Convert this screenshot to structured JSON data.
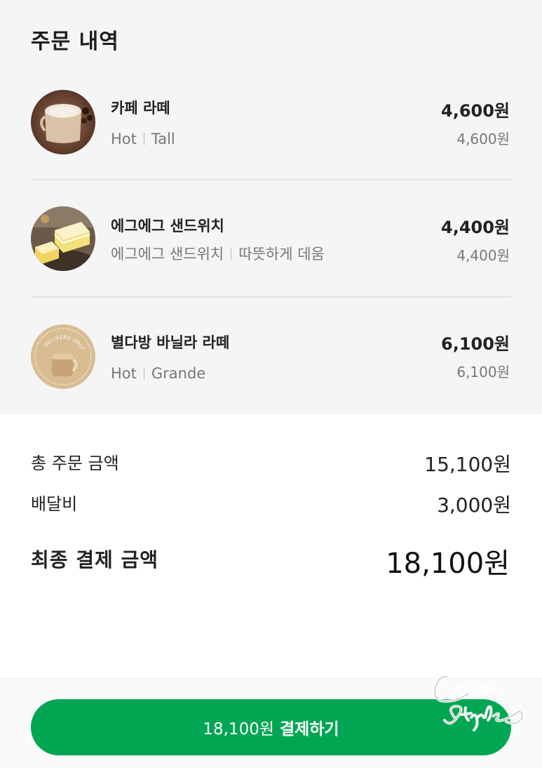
{
  "order": {
    "title": "주문 내역",
    "items": [
      {
        "name": "카페 라떼",
        "options": [
          "Hot",
          "Tall"
        ],
        "price": "4,600원",
        "subprice": "4,600원",
        "thumb_icon": "cafe-latte-image"
      },
      {
        "name": "에그에그 샌드위치",
        "options": [
          "에그에그 샌드위치",
          "따뜻하게 데움"
        ],
        "price": "4,400원",
        "subprice": "4,400원",
        "thumb_icon": "egg-sandwich-image"
      },
      {
        "name": "별다방 바닐라 라떼",
        "options": [
          "Hot",
          "Grande"
        ],
        "price": "6,100원",
        "subprice": "6,100원",
        "thumb_icon": "vanilla-latte-image",
        "badge_text": "DELIVERS ONLY"
      }
    ]
  },
  "summary": {
    "total_order_label": "총 주문 금액",
    "total_order_value": "15,100원",
    "delivery_fee_label": "배달비",
    "delivery_fee_value": "3,000원",
    "final_label": "최종 결제 금액",
    "final_value": "18,100원"
  },
  "pay_button": {
    "amount": "18,100원",
    "action": "결제하기",
    "color": "#00a651"
  },
  "watermark": {
    "text": "Lana Style"
  },
  "colors": {
    "background_top": "#f5f5f5",
    "accent": "#00a651"
  }
}
